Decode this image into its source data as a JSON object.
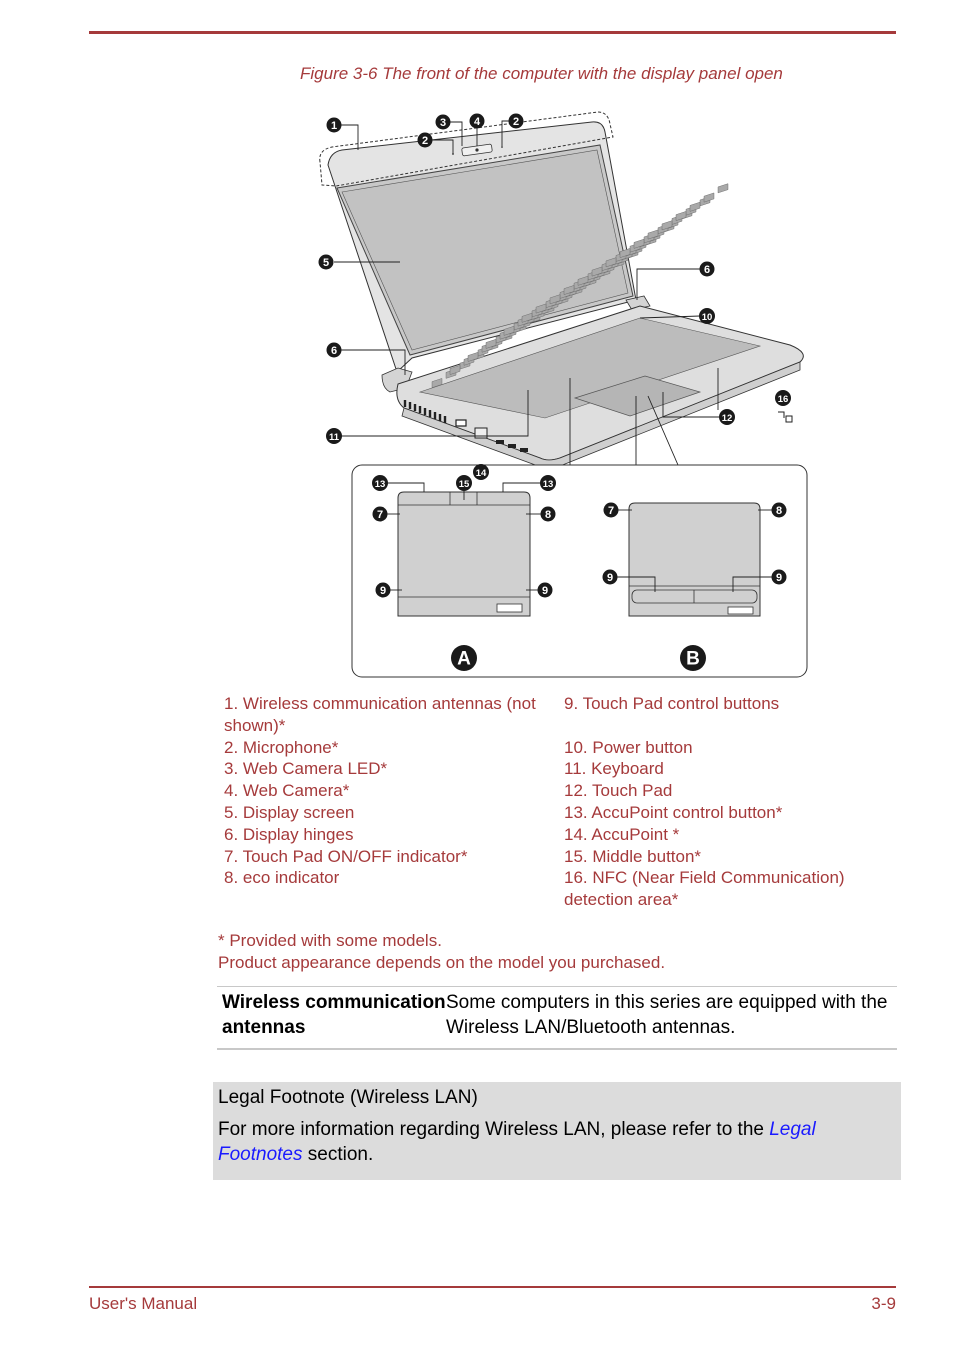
{
  "figure": {
    "caption": "Figure 3-6 The front of the computer with the display panel open",
    "callouts": [
      "1",
      "2",
      "3",
      "4",
      "2",
      "5",
      "6",
      "6",
      "10",
      "11",
      "16",
      "12",
      "14",
      "13",
      "15",
      "13",
      "7",
      "8",
      "9",
      "9",
      "7",
      "8",
      "9",
      "9"
    ],
    "variant_labels": [
      "A",
      "B"
    ],
    "indicator_icons": [
      "dc-in-battery",
      "power",
      "battery",
      "wireless",
      "storage"
    ]
  },
  "legend": {
    "left": [
      "1. Wireless communication antennas (not shown)*",
      "2. Microphone*",
      "3. Web Camera LED*",
      "4. Web Camera*",
      "5. Display screen",
      "6. Display hinges",
      "7. Touch Pad ON/OFF indicator*",
      "8. eco indicator"
    ],
    "right": [
      "9. Touch Pad control buttons",
      "10. Power button",
      "11. Keyboard",
      "12. Touch Pad",
      "13. AccuPoint control button*",
      "14. AccuPoint *",
      "15. Middle button*",
      "16. NFC (Near Field Communication) detection area*"
    ]
  },
  "notes": {
    "line1": "* Provided with some models.",
    "line2": "Product appearance depends on the model you purchased."
  },
  "definition": {
    "term": "Wireless communication antennas",
    "description": "Some computers in this series are equipped with the Wireless LAN/Bluetooth antennas."
  },
  "legal_box": {
    "title": "Legal Footnote (Wireless LAN)",
    "body_prefix": "For more information regarding Wireless LAN, please refer to the ",
    "link_text": "Legal Footnotes",
    "body_suffix": " section."
  },
  "footer": {
    "left": "User's Manual",
    "right": "3-9"
  },
  "colors": {
    "accent": "#a53a3b",
    "link": "#1a1aff",
    "box_bg": "#dcdcdc"
  }
}
